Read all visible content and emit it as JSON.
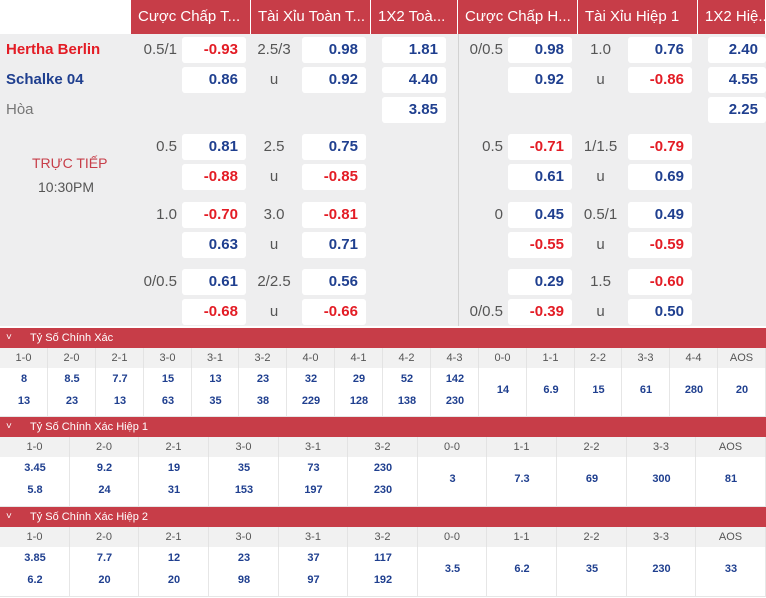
{
  "headers": [
    "Cược Chấp T...",
    "Tài Xỉu Toàn T...",
    "1X2 Toà...",
    "Cược Chấp H...",
    "Tài Xỉu Hiệp 1",
    "1X2 Hiệ..."
  ],
  "teams": {
    "home": "Hertha Berlin",
    "away": "Schalke 04",
    "draw": "Hòa"
  },
  "match": {
    "status": "TRỰC TIẾP",
    "time": "10:30PM"
  },
  "colors": {
    "accent": "#c73d48",
    "positive": "#1f3f8f",
    "negative": "#e31c25",
    "panel": "#eeeeef"
  },
  "odds_rows": [
    {
      "c1": [
        "0.5/1",
        "-0.93",
        "2.5/3",
        "0.98",
        "",
        "1.81",
        "0/0.5",
        "0.98",
        "1.0",
        "0.76",
        "",
        "2.40"
      ]
    },
    {
      "c1": [
        "",
        "0.86",
        "u",
        "0.92",
        "",
        "4.40",
        "",
        "0.92",
        "u",
        "-0.86",
        "",
        "4.55"
      ]
    },
    {
      "c1": [
        "",
        "",
        "",
        "",
        "",
        "3.85",
        "",
        "",
        "",
        "",
        "",
        "2.25"
      ]
    },
    {
      "c1": [
        "0.5",
        "0.81",
        "2.5",
        "0.75",
        "",
        "",
        "0.5",
        "-0.71",
        "1/1.5",
        "-0.79",
        "",
        ""
      ]
    },
    {
      "c1": [
        "",
        "-0.88",
        "u",
        "-0.85",
        "",
        "",
        "",
        "0.61",
        "u",
        "0.69",
        "",
        ""
      ]
    },
    {
      "c1": [
        "1.0",
        "-0.70",
        "3.0",
        "-0.81",
        "",
        "",
        "0",
        "0.45",
        "0.5/1",
        "0.49",
        "",
        ""
      ]
    },
    {
      "c1": [
        "",
        "0.63",
        "u",
        "0.71",
        "",
        "",
        "",
        "-0.55",
        "u",
        "-0.59",
        "",
        ""
      ]
    },
    {
      "c1": [
        "0/0.5",
        "0.61",
        "2/2.5",
        "0.56",
        "",
        "",
        "",
        "0.29",
        "1.5",
        "-0.60",
        "",
        ""
      ]
    },
    {
      "c1": [
        "",
        "-0.68",
        "u",
        "-0.66",
        "",
        "",
        "0/0.5",
        "-0.39",
        "u",
        "0.50",
        "",
        ""
      ]
    }
  ],
  "sections": [
    {
      "title": "Tỷ Số Chính Xác",
      "cols": [
        "1-0",
        "2-0",
        "2-1",
        "3-0",
        "3-1",
        "3-2",
        "4-0",
        "4-1",
        "4-2",
        "4-3",
        "0-0",
        "1-1",
        "2-2",
        "3-3",
        "4-4",
        "AOS"
      ],
      "top": [
        "8",
        "8.5",
        "7.7",
        "15",
        "13",
        "23",
        "32",
        "29",
        "52",
        "142",
        "14",
        "6.9",
        "15",
        "61",
        "280",
        "20"
      ],
      "bottom": [
        "13",
        "23",
        "13",
        "63",
        "35",
        "38",
        "229",
        "128",
        "138",
        "230",
        "",
        "",
        "",
        "",
        "",
        ""
      ]
    },
    {
      "title": "Tỷ Số Chính Xác Hiệp 1",
      "cols": [
        "1-0",
        "2-0",
        "2-1",
        "3-0",
        "3-1",
        "3-2",
        "0-0",
        "1-1",
        "2-2",
        "3-3",
        "AOS"
      ],
      "top": [
        "3.45",
        "9.2",
        "19",
        "35",
        "73",
        "230",
        "3",
        "7.3",
        "69",
        "300",
        "81"
      ],
      "bottom": [
        "5.8",
        "24",
        "31",
        "153",
        "197",
        "230",
        "",
        "",
        "",
        "",
        ""
      ]
    },
    {
      "title": "Tỷ Số Chính Xác Hiệp 2",
      "cols": [
        "1-0",
        "2-0",
        "2-1",
        "3-0",
        "3-1",
        "3-2",
        "0-0",
        "1-1",
        "2-2",
        "3-3",
        "AOS"
      ],
      "top": [
        "3.85",
        "7.7",
        "12",
        "23",
        "37",
        "117",
        "3.5",
        "6.2",
        "35",
        "230",
        "33"
      ],
      "bottom": [
        "6.2",
        "20",
        "20",
        "98",
        "97",
        "192",
        "",
        "",
        "",
        "",
        ""
      ]
    }
  ]
}
